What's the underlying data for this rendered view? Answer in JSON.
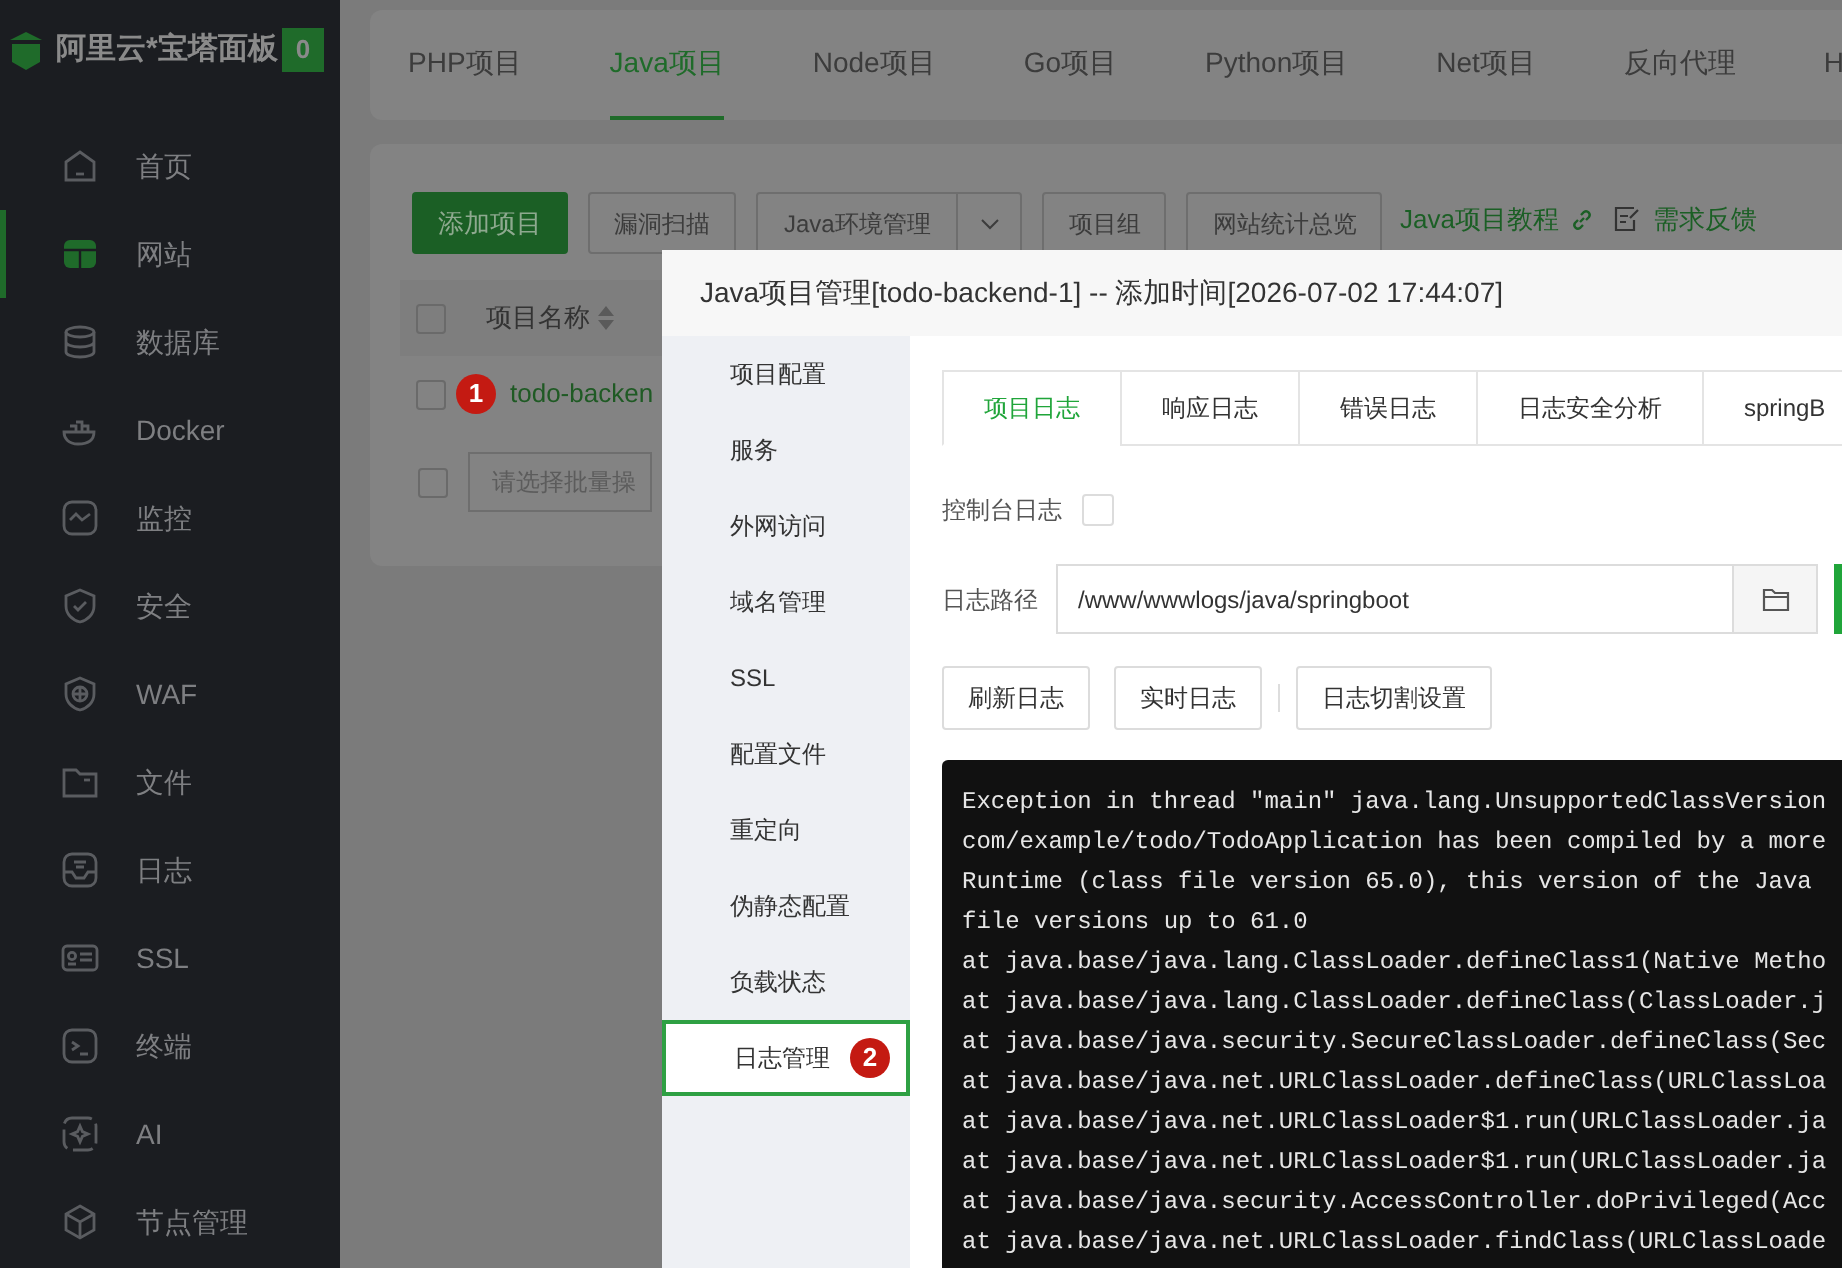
{
  "sidebar": {
    "brand": "阿里云*宝塔面板",
    "badge": "0",
    "items": [
      {
        "label": "首页",
        "selected": false
      },
      {
        "label": "网站",
        "selected": true
      },
      {
        "label": "数据库",
        "selected": false
      },
      {
        "label": "Docker",
        "selected": false
      },
      {
        "label": "监控",
        "selected": false
      },
      {
        "label": "安全",
        "selected": false
      },
      {
        "label": "WAF",
        "selected": false
      },
      {
        "label": "文件",
        "selected": false
      },
      {
        "label": "日志",
        "selected": false
      },
      {
        "label": "SSL",
        "selected": false
      },
      {
        "label": "终端",
        "selected": false
      },
      {
        "label": "AI",
        "selected": false
      },
      {
        "label": "节点管理",
        "selected": false
      }
    ]
  },
  "project_tabs": [
    {
      "label": "PHP项目",
      "selected": false
    },
    {
      "label": "Java项目",
      "selected": true
    },
    {
      "label": "Node项目",
      "selected": false
    },
    {
      "label": "Go项目",
      "selected": false
    },
    {
      "label": "Python项目",
      "selected": false
    },
    {
      "label": "Net项目",
      "selected": false
    },
    {
      "label": "反向代理",
      "selected": false
    },
    {
      "label": "H",
      "selected": false
    }
  ],
  "toolbar": {
    "buttons": [
      {
        "label": "添加项目",
        "kind": "primary"
      },
      {
        "label": "漏洞扫描",
        "kind": "default"
      },
      {
        "label": "Java环境管理",
        "kind": "dropdown"
      },
      {
        "label": "项目组",
        "kind": "default"
      },
      {
        "label": "网站统计总览",
        "kind": "default"
      }
    ],
    "tutorial_link": "Java项目教程",
    "feedback_link": "需求反馈"
  },
  "table": {
    "columns": [
      "项目名称"
    ],
    "select_all_checked": false,
    "rows": [
      {
        "name": "todo-backen",
        "checked": false,
        "annotation": "1"
      }
    ],
    "batch_select": {
      "checked": false,
      "placeholder": "请选择批量操"
    }
  },
  "modal": {
    "title": "Java项目管理[todo-backend-1] -- 添加时间[2026-07-02 17:44:07]",
    "menu": [
      {
        "label": "项目配置",
        "selected": false
      },
      {
        "label": "服务",
        "selected": false
      },
      {
        "label": "外网访问",
        "selected": false
      },
      {
        "label": "域名管理",
        "selected": false
      },
      {
        "label": "SSL",
        "selected": false
      },
      {
        "label": "配置文件",
        "selected": false
      },
      {
        "label": "重定向",
        "selected": false
      },
      {
        "label": "伪静态配置",
        "selected": false
      },
      {
        "label": "负载状态",
        "selected": false
      },
      {
        "label": "日志管理",
        "selected": true,
        "annotation": "2"
      }
    ],
    "tabs": [
      {
        "label": "项目日志",
        "selected": true
      },
      {
        "label": "响应日志",
        "selected": false
      },
      {
        "label": "错误日志",
        "selected": false
      },
      {
        "label": "日志安全分析",
        "selected": false
      },
      {
        "label": "springB",
        "selected": false
      }
    ],
    "console_log": {
      "label": "控制台日志",
      "checked": false
    },
    "log_path": {
      "label": "日志路径",
      "value": "/www/wwwlogs/java/springboot"
    },
    "buttons": [
      "刷新日志",
      "实时日志",
      "日志切割设置"
    ],
    "log_lines": [
      "Exception in thread \"main\" java.lang.UnsupportedClassVersion",
      "com/example/todo/TodoApplication has been compiled by a more",
      "Runtime (class file version 65.0), this version of the Java",
      "file versions up to 61.0",
      "at java.base/java.lang.ClassLoader.defineClass1(Native Metho",
      "at java.base/java.lang.ClassLoader.defineClass(ClassLoader.j",
      "at java.base/java.security.SecureClassLoader.defineClass(Sec",
      "at java.base/java.net.URLClassLoader.defineClass(URLClassLoa",
      "at java.base/java.net.URLClassLoader$1.run(URLClassLoader.ja",
      "at java.base/java.net.URLClassLoader$1.run(URLClassLoader.ja",
      "at java.base/java.security.AccessController.doPrivileged(Acc",
      "at java.base/java.net.URLClassLoader.findClass(URLClassLoade"
    ]
  }
}
